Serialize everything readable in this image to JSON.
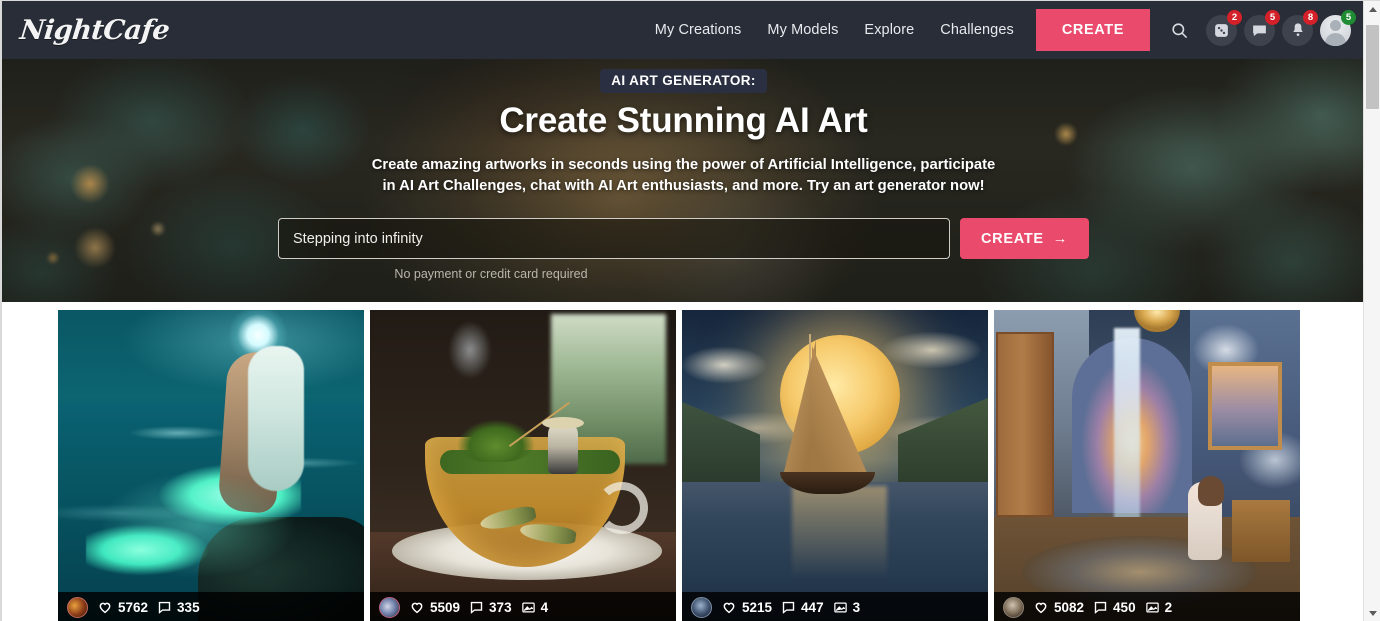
{
  "brand": {
    "name": "NightCafe"
  },
  "nav": {
    "links": [
      {
        "label": "My Creations"
      },
      {
        "label": "My Models"
      },
      {
        "label": "Explore"
      },
      {
        "label": "Challenges"
      }
    ],
    "create_button": "CREATE",
    "icons": [
      {
        "name": "search-icon",
        "badge": ""
      },
      {
        "name": "dice-icon",
        "badge": "2"
      },
      {
        "name": "chat-icon",
        "badge": "5"
      },
      {
        "name": "bell-icon",
        "badge": "8"
      },
      {
        "name": "avatar-icon",
        "badge": "5"
      }
    ]
  },
  "hero": {
    "badge": "AI ART GENERATOR:",
    "title": "Create Stunning AI Art",
    "subtitle": "Create amazing artworks in seconds using the power of Artificial Intelligence, participate in AI Art Challenges, chat with AI Art enthusiasts, and more. Try an art generator now!",
    "prompt_value": "Stepping into infinity",
    "prompt_placeholder": "Stepping into infinity",
    "create_button": "CREATE",
    "create_arrow": "→",
    "note": "No payment or credit card required"
  },
  "gallery": {
    "cards": [
      {
        "alt": "Glowing bioluminescent mermaid sitting on a rock under a full moon",
        "likes": "5762",
        "comments": "335",
        "images": ""
      },
      {
        "alt": "Miniature fisherman sitting on a teacup with fish swimming inside",
        "likes": "5509",
        "comments": "373",
        "images": "4"
      },
      {
        "alt": "Sailboat on calm water in front of a giant golden moon",
        "likes": "5215",
        "comments": "447",
        "images": "3"
      },
      {
        "alt": "Surreal room with an indoor waterfall and a woman seated by a pool",
        "likes": "5082",
        "comments": "450",
        "images": "2"
      }
    ]
  },
  "colors": {
    "nav_background": "#282d37",
    "accent_pink": "#ea4a6b",
    "badge_red": "#d32029",
    "badge_green": "#1f8b32",
    "hero_badge_background": "#2a3041"
  }
}
